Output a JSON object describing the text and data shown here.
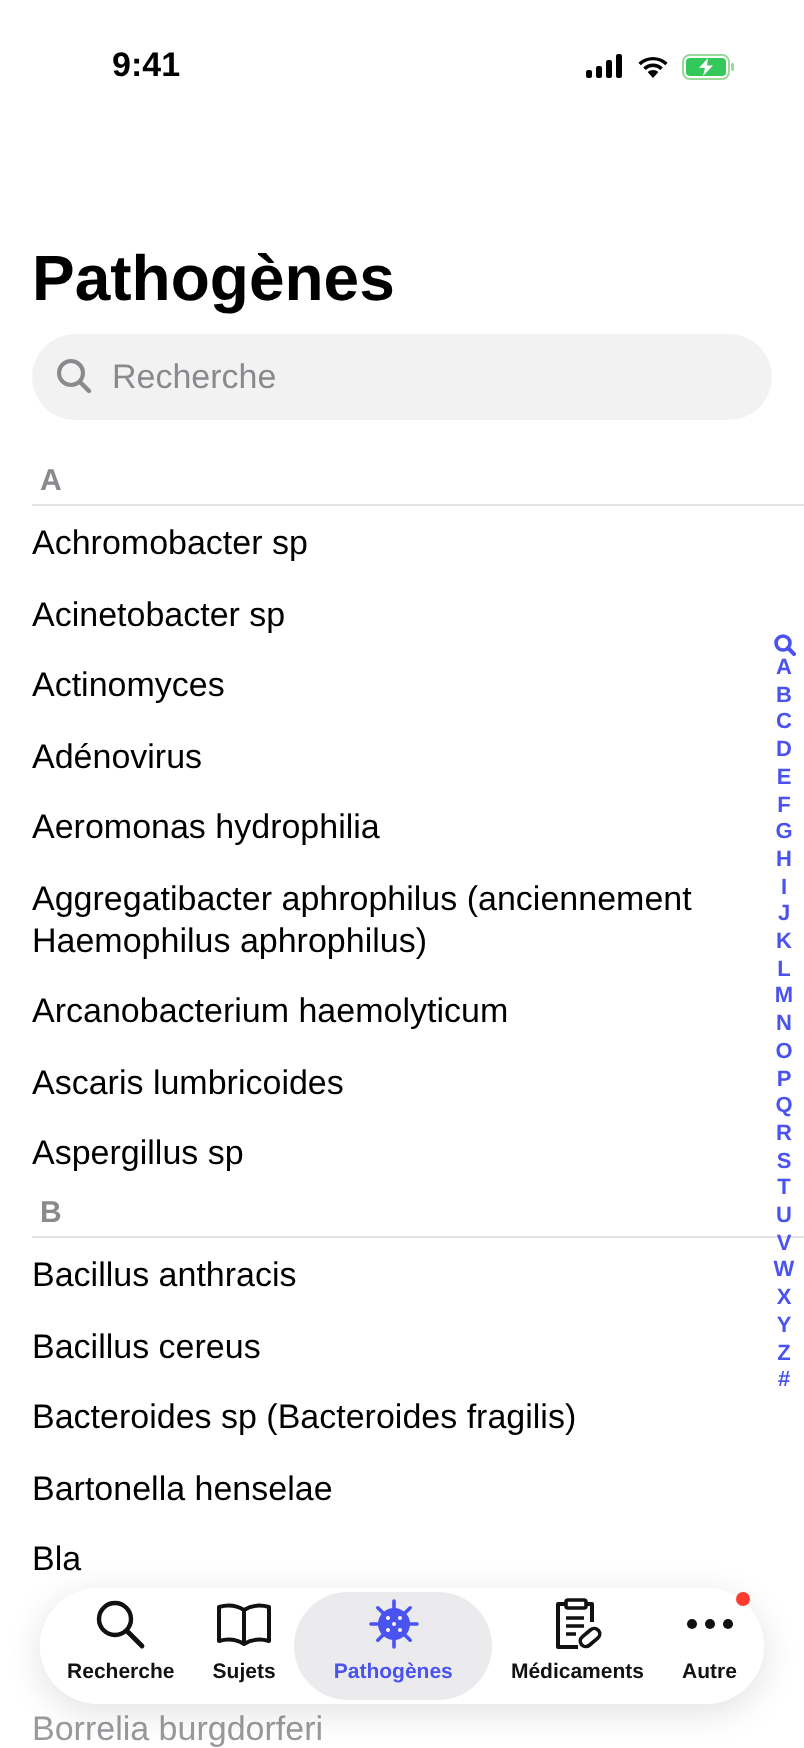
{
  "status_bar": {
    "time": "9:41"
  },
  "title": "Pathogènes",
  "search": {
    "placeholder": "Recherche"
  },
  "sections": [
    {
      "letter": "A",
      "items": [
        {
          "name": "Achromobacter sp",
          "dimmed": false
        },
        {
          "name": "Acinetobacter sp",
          "dimmed": false
        },
        {
          "name": "Actinomyces",
          "dimmed": false
        },
        {
          "name": "Adénovirus",
          "dimmed": false
        },
        {
          "name": "Aeromonas hydrophilia",
          "dimmed": false
        },
        {
          "name": "Aggregatibacter aphrophilus (anciennement Haemophilus aphrophilus)",
          "dimmed": false
        },
        {
          "name": "Arcanobacterium haemolyticum",
          "dimmed": false
        },
        {
          "name": "Ascaris lumbricoides",
          "dimmed": false
        },
        {
          "name": "Aspergillus sp",
          "dimmed": false
        }
      ]
    },
    {
      "letter": "B",
      "items": [
        {
          "name": "Bacillus anthracis",
          "dimmed": false
        },
        {
          "name": "Bacillus cereus",
          "dimmed": false
        },
        {
          "name": "Bacteroides sp (Bacteroides fragilis)",
          "dimmed": false
        },
        {
          "name": "Bartonella henselae",
          "dimmed": false
        },
        {
          "name": "Bla",
          "dimmed": false
        },
        {
          "name": "Borrelia burgdorferi",
          "dimmed": true
        }
      ]
    }
  ],
  "index": [
    "A",
    "B",
    "C",
    "D",
    "E",
    "F",
    "G",
    "H",
    "I",
    "J",
    "K",
    "L",
    "M",
    "N",
    "O",
    "P",
    "Q",
    "R",
    "S",
    "T",
    "U",
    "V",
    "W",
    "X",
    "Y",
    "Z",
    "#"
  ],
  "tabs": [
    {
      "kind": "search",
      "label": "Recherche",
      "selected": false,
      "badge": false
    },
    {
      "kind": "book",
      "label": "Sujets",
      "selected": false,
      "badge": false
    },
    {
      "kind": "virus",
      "label": "Pathogènes",
      "selected": true,
      "badge": false
    },
    {
      "kind": "clipboard",
      "label": "Médicaments",
      "selected": false,
      "badge": false
    },
    {
      "kind": "more",
      "label": "Autre",
      "selected": false,
      "badge": true
    }
  ]
}
